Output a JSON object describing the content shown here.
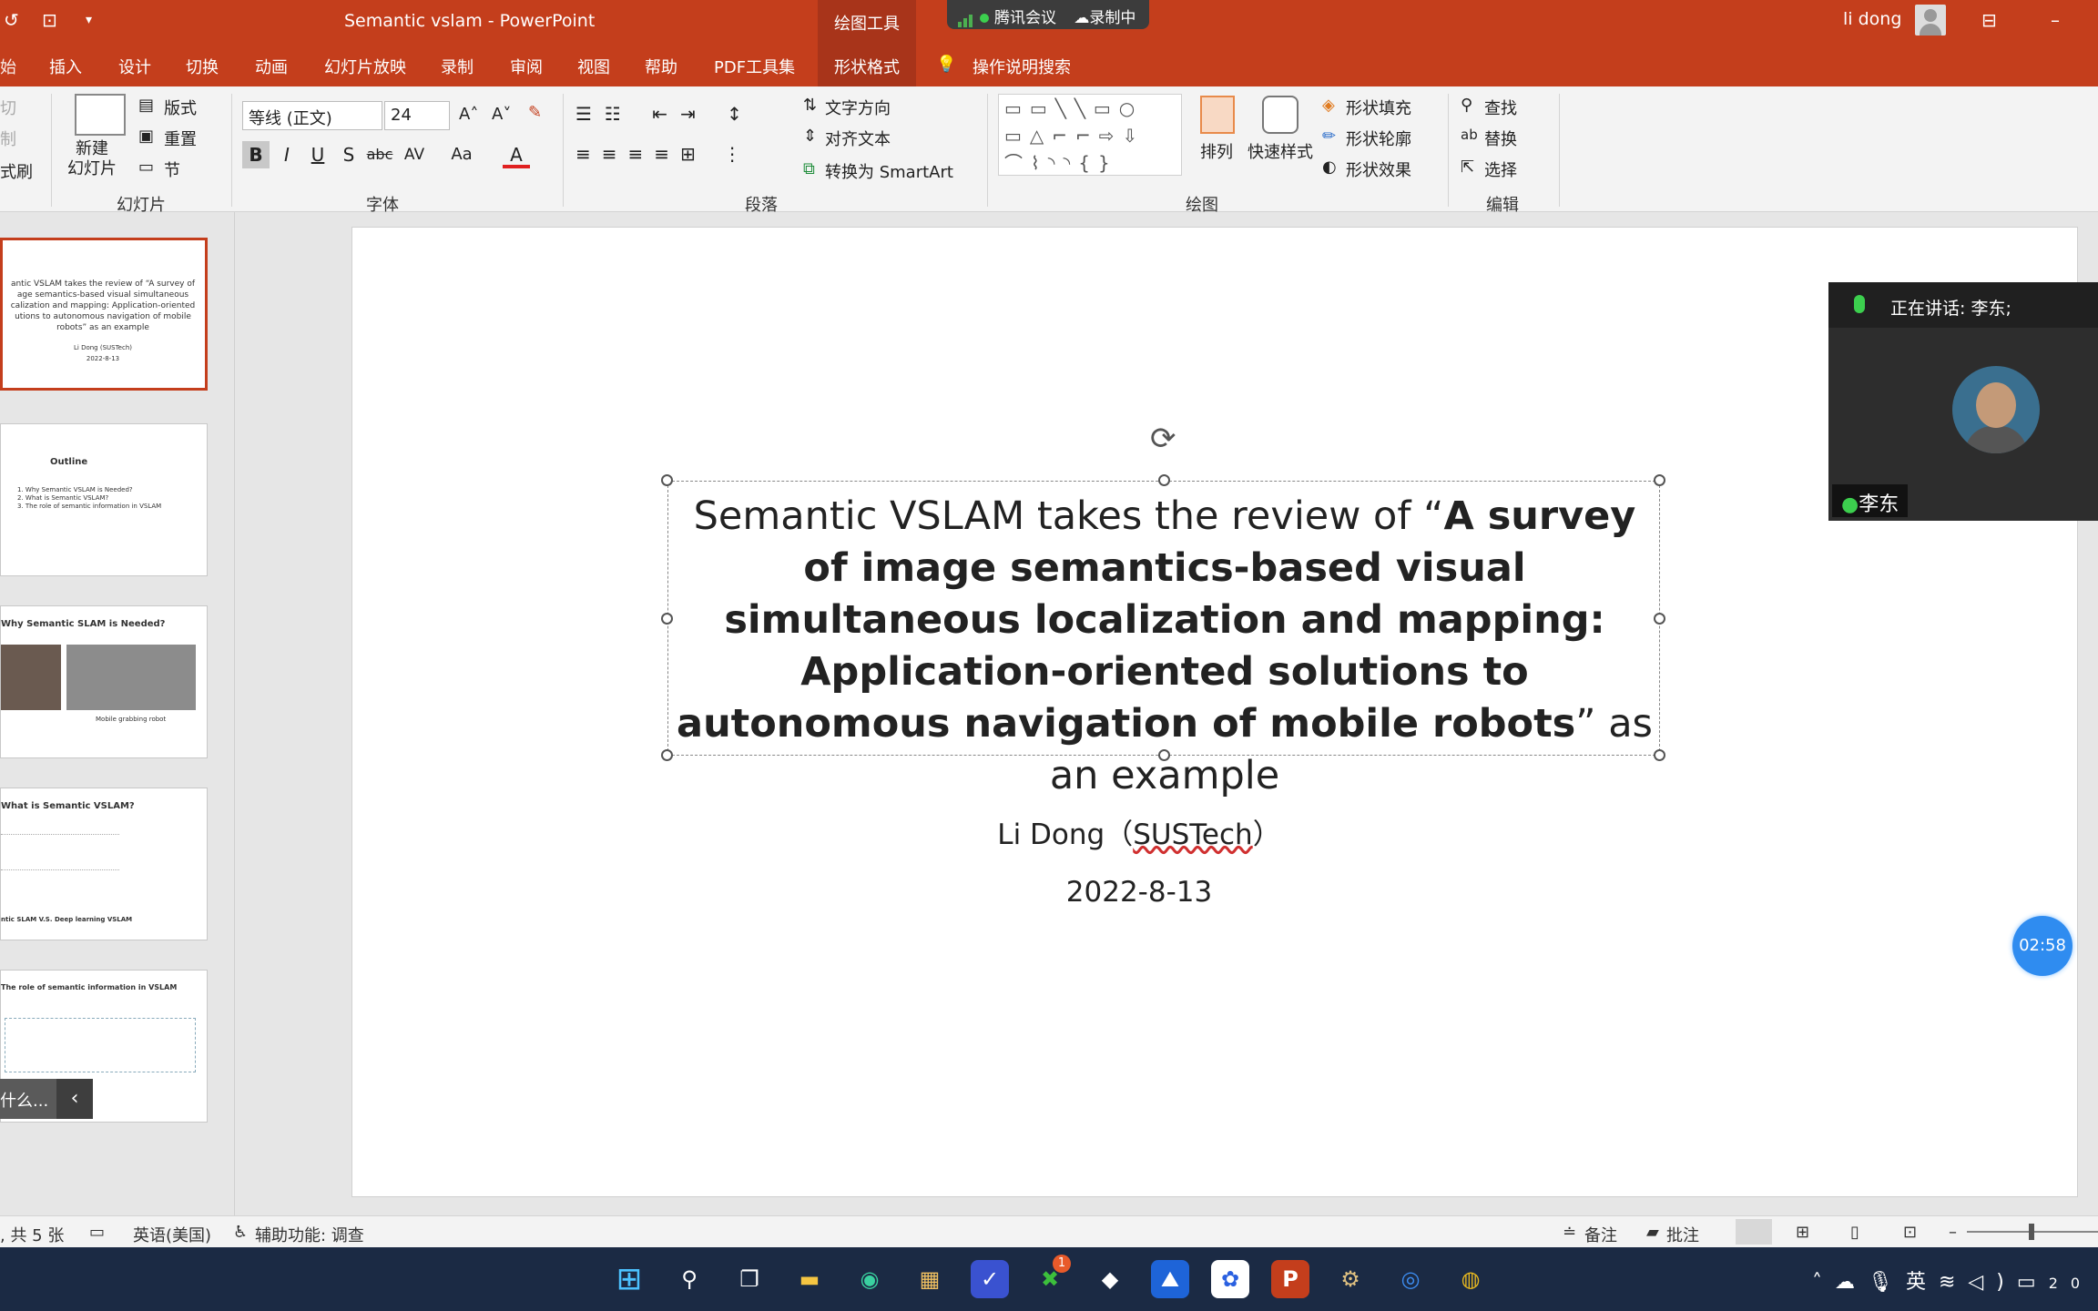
{
  "titlebar": {
    "title": "Semantic vslam  -  PowerPoint",
    "context_tools": "绘图工具",
    "meeting": "腾讯会议",
    "recording": "录制中",
    "user": "li dong"
  },
  "tabs": [
    "始",
    "插入",
    "设计",
    "切换",
    "动画",
    "幻灯片放映",
    "录制",
    "审阅",
    "视图",
    "帮助",
    "PDF工具集",
    "形状格式",
    "操作说明搜索"
  ],
  "ribbon": {
    "clipboard": {
      "cut": "切",
      "copy": "制",
      "format_painter": "式刷"
    },
    "slides": {
      "new_slide": "新建\n幻灯片",
      "layout": "版式",
      "reset": "重置",
      "section": "节",
      "group": "幻灯片"
    },
    "font": {
      "name": "等线 (正文)",
      "size": "24",
      "group": "字体",
      "bold": "B",
      "italic": "I",
      "underline": "U",
      "shadow": "S",
      "strike": "abc",
      "spacing": "AV",
      "case": "Aa",
      "color": "A"
    },
    "paragraph": {
      "text_direction": "文字方向",
      "align_text": "对齐文本",
      "smartart": "转换为 SmartArt",
      "group": "段落"
    },
    "drawing": {
      "arrange": "排列",
      "quick_styles": "快速样式",
      "fill": "形状填充",
      "outline": "形状轮廓",
      "effects": "形状效果",
      "group": "绘图"
    },
    "editing": {
      "find": "查找",
      "replace": "替换",
      "select": "选择",
      "group": "编辑"
    }
  },
  "thumbnails": [
    {
      "line1": "antic VSLAM takes the review of “A survey of",
      "line2": "age semantics-based visual simultaneous",
      "line3": "calization and mapping: Application-oriented",
      "line4": "utions to autonomous navigation of mobile",
      "line5": "robots” as an example",
      "author": "Li Dong  (SUSTech)",
      "date": "2022-8-13"
    },
    {
      "title": "Outline",
      "items": [
        "1. Why Semantic VSLAM is Needed?",
        "2. What is Semantic VSLAM?",
        "3. The role of semantic information in VSLAM"
      ]
    },
    {
      "title": "Why Semantic SLAM is Needed?",
      "caption": "Mobile grabbing robot"
    },
    {
      "title": "What is Semantic VSLAM?",
      "footer": "ntic SLAM V.S. Deep learning  VSLAM"
    },
    {
      "title": "The role of semantic information in VSLAM"
    }
  ],
  "thumb_tip": "什么...",
  "slide": {
    "title_normal_1": "Semantic VSLAM takes the review of “",
    "title_bold": "A survey of image semantics-based visual simultaneous localization and mapping: Application-oriented solutions to autonomous navigation of mobile robots",
    "title_normal_2": "” as an example",
    "author_name": "Li Dong",
    "author_aff": "SUSTech",
    "date": "2022-8-13"
  },
  "video": {
    "speaking": "正在讲话: 李东;",
    "name": "李东"
  },
  "timer": "02:58",
  "status": {
    "slides": ", 共 5 张",
    "language": "英语(美国)",
    "accessibility": "辅助功能: 调查",
    "notes": "备注",
    "comments": "批注"
  },
  "taskbar": {
    "ime": "英",
    "xbox_badge": "1",
    "clock": "20"
  }
}
